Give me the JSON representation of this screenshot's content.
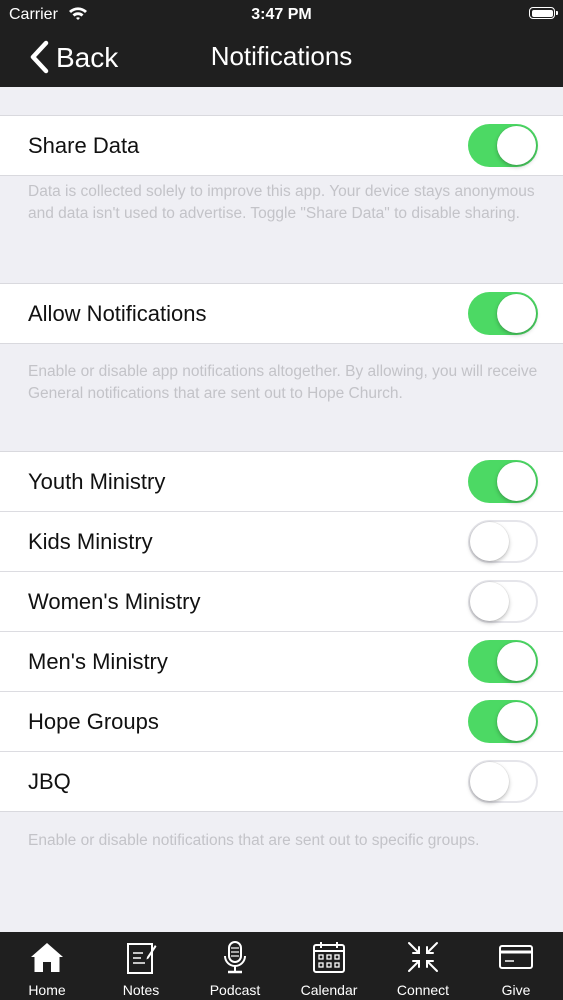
{
  "status_bar": {
    "carrier": "Carrier",
    "time": "3:47 PM"
  },
  "nav": {
    "back_label": "Back",
    "title": "Notifications"
  },
  "sections": [
    {
      "rows": [
        {
          "label": "Share Data",
          "on": true
        }
      ],
      "footnote": "Data is collected solely to improve this app. Your device stays anonymous and data isn't used to advertise. Toggle \"Share Data\" to disable sharing."
    },
    {
      "rows": [
        {
          "label": "Allow Notifications",
          "on": true
        }
      ],
      "footnote": "Enable or disable app notifications altogether. By allowing, you will receive General notifications that are sent out to Hope Church."
    },
    {
      "rows": [
        {
          "label": "Youth Ministry",
          "on": true
        },
        {
          "label": "Kids Ministry",
          "on": false
        },
        {
          "label": "Women's Ministry",
          "on": false
        },
        {
          "label": "Men's Ministry",
          "on": true
        },
        {
          "label": "Hope Groups",
          "on": true
        },
        {
          "label": "JBQ",
          "on": false
        }
      ],
      "footnote": "Enable or disable notifications that are sent out to specific groups."
    }
  ],
  "tab_bar": {
    "tabs": [
      {
        "label": "Home",
        "icon": "home-icon"
      },
      {
        "label": "Notes",
        "icon": "notes-icon"
      },
      {
        "label": "Podcast",
        "icon": "microphone-icon"
      },
      {
        "label": "Calendar",
        "icon": "calendar-icon"
      },
      {
        "label": "Connect",
        "icon": "connect-arrows-icon"
      },
      {
        "label": "Give",
        "icon": "credit-card-icon"
      }
    ]
  },
  "colors": {
    "bar_background": "#1f1f1f",
    "toggle_on": "#4cd964",
    "page_background": "#efeff4",
    "footnote_text": "#c3c3c8"
  }
}
